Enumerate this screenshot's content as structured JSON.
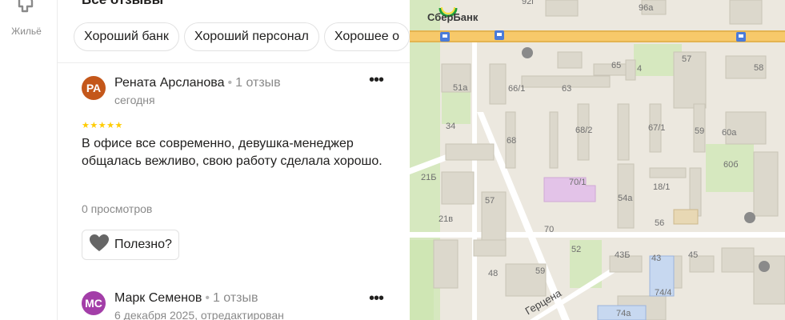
{
  "rail": {
    "items": [
      {
        "label": "Жильё",
        "icon": "home-pin-icon"
      }
    ]
  },
  "reviews": {
    "section_title": "Все отзывы",
    "chips": [
      "Хороший банк",
      "Хороший персонал",
      "Хорошее о"
    ],
    "items": [
      {
        "initials": "РА",
        "avatar_color": "#c4571a",
        "name": "Рената Арсланова",
        "review_count": "1 отзыв",
        "date": "сегодня",
        "rating": "★★★★★",
        "text": "В офисе все современно, девушка-менеджер общалась вежливо, свою работу сделала хорошо.",
        "views": "0 просмотров",
        "useful_label": "Полезно?"
      },
      {
        "initials": "МС",
        "avatar_color": "#a33ea8",
        "name": "Марк Семенов",
        "review_count": "1 отзыв",
        "date": "6 декабря 2025, отредактирован"
      }
    ]
  },
  "map": {
    "poi_label": "СберБанк",
    "street_label": "Герцена",
    "house_numbers": [
      "92г",
      "96а",
      "57",
      "58",
      "65",
      "4",
      "51а",
      "66/1",
      "63",
      "34",
      "68/2",
      "67/1",
      "59",
      "60а",
      "68",
      "60б",
      "21Б",
      "70/1",
      "18/1",
      "54а",
      "57",
      "21в",
      "56",
      "70",
      "52",
      "43Б",
      "43",
      "45",
      "48",
      "59",
      "74/4",
      "74а"
    ],
    "colors": {
      "background": "#ece8df",
      "main_road": "#f7c96a",
      "building": "#dcd8cc",
      "park": "#cfe6b4",
      "highlight": "#e3c3e8",
      "transit": "#4b7bd9"
    }
  }
}
